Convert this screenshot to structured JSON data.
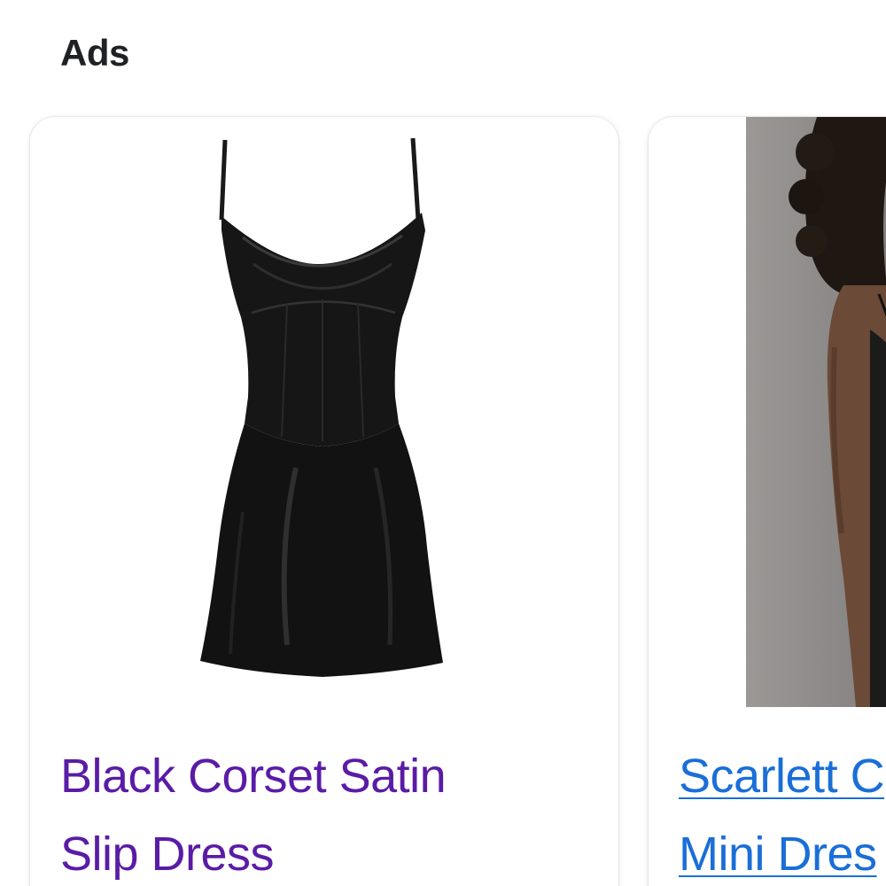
{
  "section": {
    "label": "Ads"
  },
  "ads": [
    {
      "title_line1": "Black Corset Satin",
      "title_line2": "Slip Dress",
      "image": "black-satin-corset-slip-dress-photo",
      "title_color": "#5a1ca6"
    },
    {
      "title_line1": "Scarlett C",
      "title_line2": "Mini Dres",
      "image": "model-wearing-black-slip-dress-photo",
      "title_color": "#1a6ed8"
    }
  ]
}
